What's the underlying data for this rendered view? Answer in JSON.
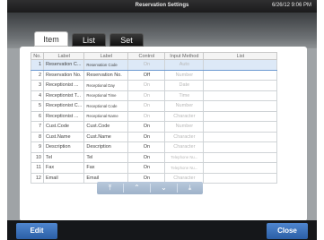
{
  "window": {
    "title": "Reservation Settings",
    "clock": "6/26/12 9:06 PM"
  },
  "tabs": [
    {
      "label": "Item"
    },
    {
      "label": "List"
    },
    {
      "label": "Set"
    }
  ],
  "table": {
    "headers": [
      "No.",
      "Label",
      "Label",
      "Control",
      "Input Method",
      "List"
    ],
    "rows": [
      {
        "no": "1",
        "label": "Reservation C...",
        "label2": "Reservation Code",
        "control": "On",
        "input": "Auto",
        "list": ""
      },
      {
        "no": "2",
        "label": "Reservation No.",
        "label2": "Reservation No.",
        "control": "Off",
        "input": "Number",
        "list": ""
      },
      {
        "no": "3",
        "label": "Receptionist ...",
        "label2": "Receptional Day",
        "control": "On",
        "input": "Date",
        "list": ""
      },
      {
        "no": "4",
        "label": "Receptionist T...",
        "label2": "Receptional Time",
        "control": "On",
        "input": "Time",
        "list": ""
      },
      {
        "no": "5",
        "label": "Receptionist C...",
        "label2": "Receptional Code",
        "control": "On",
        "input": "Number",
        "list": ""
      },
      {
        "no": "6",
        "label": "Receptionist ...",
        "label2": "Receptional Name",
        "control": "On",
        "input": "Character",
        "list": ""
      },
      {
        "no": "7",
        "label": "Cust.Code",
        "label2": "Cust.Code",
        "control": "On",
        "input": "Number",
        "list": ""
      },
      {
        "no": "8",
        "label": "Cust.Name",
        "label2": "Cust.Name",
        "control": "On",
        "input": "Character",
        "list": ""
      },
      {
        "no": "9",
        "label": "Description",
        "label2": "Description",
        "control": "On",
        "input": "Character",
        "list": ""
      },
      {
        "no": "10",
        "label": "Tel",
        "label2": "Tel",
        "control": "On",
        "input": "Telephone Nu...",
        "list": ""
      },
      {
        "no": "11",
        "label": "Fax",
        "label2": "Fax",
        "control": "On",
        "input": "Telephone Nu...",
        "list": ""
      },
      {
        "no": "12",
        "label": "Email",
        "label2": "Email",
        "control": "On",
        "input": "Character",
        "list": ""
      }
    ]
  },
  "nav": {
    "top": "⤒",
    "up": "⌃",
    "down": "⌄",
    "bottom": "⤓"
  },
  "actions": {
    "edit": "Edit",
    "close": "Close"
  }
}
